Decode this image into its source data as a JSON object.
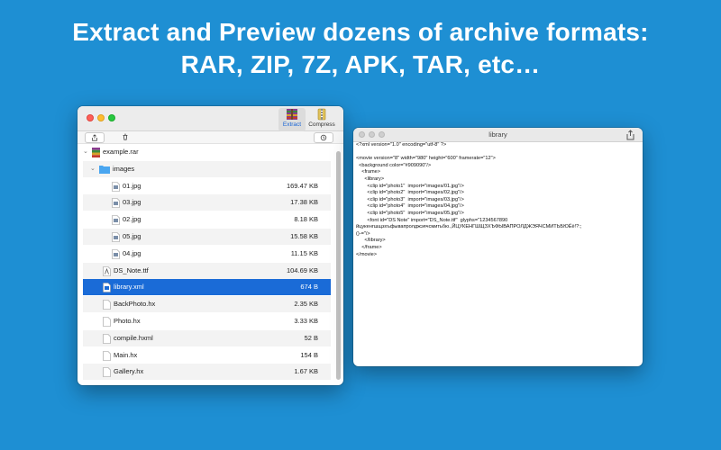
{
  "headline": {
    "line1": "Extract and Preview dozens of archive formats:",
    "line2": "RAR, ZIP, 7Z, APK, TAR, etc…"
  },
  "archive_window": {
    "toolbar": {
      "extract_label": "Extract",
      "compress_label": "Compress"
    },
    "subbar": {
      "share_icon": "share-icon",
      "trash_icon": "trash-icon",
      "history_icon": "history-icon"
    },
    "rows": [
      {
        "name": "example.rar",
        "size": "",
        "icon": "rar-icon"
      },
      {
        "name": "images",
        "size": "",
        "icon": "folder-icon"
      },
      {
        "name": "01.jpg",
        "size": "169.47 KB",
        "icon": "image-file-icon"
      },
      {
        "name": "03.jpg",
        "size": "17.38 KB",
        "icon": "image-file-icon"
      },
      {
        "name": "02.jpg",
        "size": "8.18 KB",
        "icon": "image-file-icon"
      },
      {
        "name": "05.jpg",
        "size": "15.58 KB",
        "icon": "image-file-icon"
      },
      {
        "name": "04.jpg",
        "size": "11.15 KB",
        "icon": "image-file-icon"
      },
      {
        "name": "DS_Note.ttf",
        "size": "104.69 KB",
        "icon": "font-file-icon"
      },
      {
        "name": "library.xml",
        "size": "674 B",
        "icon": "xml-file-icon"
      },
      {
        "name": "BackPhoto.hx",
        "size": "2.35 KB",
        "icon": "document-icon"
      },
      {
        "name": "Photo.hx",
        "size": "3.33 KB",
        "icon": "document-icon"
      },
      {
        "name": "compile.hxml",
        "size": "52 B",
        "icon": "document-icon"
      },
      {
        "name": "Main.hx",
        "size": "154 B",
        "icon": "document-icon"
      },
      {
        "name": "Gallery.hx",
        "size": "1.67 KB",
        "icon": "document-icon"
      }
    ],
    "selected_index": 8
  },
  "library_window": {
    "title": "library",
    "code_lines": [
      "<?xml version=\"1.0\" encoding=\"utf-8\" ?>",
      "",
      "<movie version=\"8\" width=\"980\" height=\"600\" framerate=\"12\">",
      "  <background color=\"#909090\"/>",
      "    <frame>",
      "      <library>",
      "        <clip id=\"photo1\"  import=\"images/01.jpg\"/>",
      "        <clip id=\"photo2\"  import=\"images/02.jpg\"/>",
      "        <clip id=\"photo3\"  import=\"images/03.jpg\"/>",
      "        <clip id=\"photo4\"  import=\"images/04.jpg\"/>",
      "        <clip id=\"photo5\"  import=\"images/05.jpg\"/>",
      "        <font id=\"DS Note\" import=\"DS_Note.ttf\"  glyphs=\"1234567890",
      "йцукенгшщзхъфывапролджэячсмитьбю.,ЙЦУКЕНГШЩЗХЪФЫВАПРОЛДЖЭЯЧСМИТЬБЮЁё!?:;",
      "()-=\"/>",
      "      </library>",
      "    </frame>",
      "</movie>"
    ]
  },
  "colors": {
    "background": "#1e8fd3",
    "selection": "#1a6bd7",
    "folder": "#4aa6f0"
  }
}
